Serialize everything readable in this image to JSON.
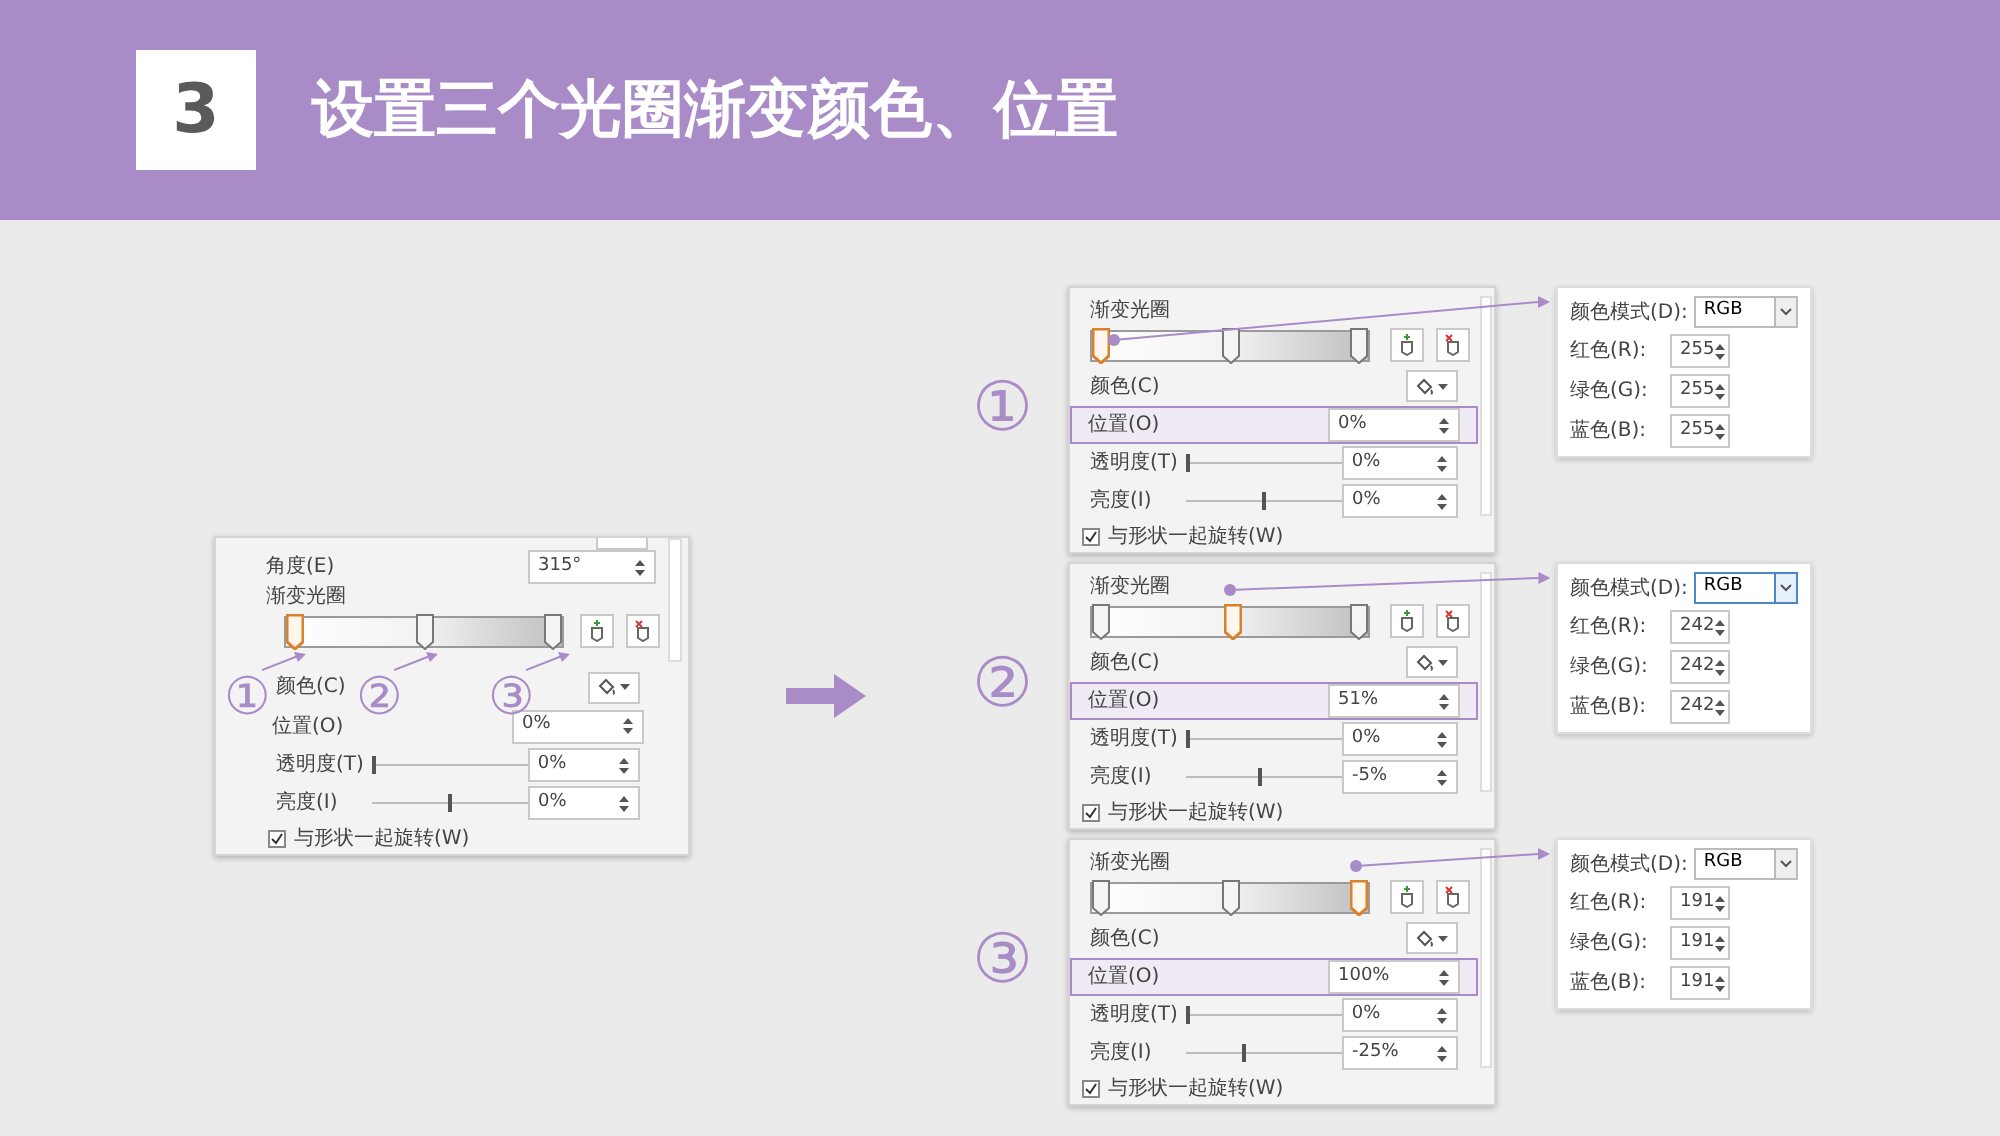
{
  "header": {
    "step": "3",
    "title": "设置三个光圈渐变颜色、位置"
  },
  "source_panel": {
    "angle_label": "角度(E)",
    "angle_value": "315°",
    "stops_label": "渐变光圈",
    "stops": [
      {
        "level": 0,
        "selected": true
      },
      {
        "level": 0.5,
        "selected": false
      },
      {
        "level": 1,
        "selected": false
      }
    ],
    "callouts": [
      "①",
      "②",
      "③"
    ],
    "color_label": "颜色(C)",
    "position": {
      "label": "位置(O)",
      "value": "0%"
    },
    "transparency": {
      "label": "透明度(T)",
      "level": 0,
      "value": "0%"
    },
    "brightness": {
      "label": "亮度(I)",
      "level": 0.5,
      "value": "0%"
    },
    "rotate": {
      "label": "与形状一起旋转(W)",
      "checked": true
    }
  },
  "steps": [
    {
      "number": "①",
      "panel": {
        "stops_label": "渐变光圈",
        "stops": [
          {
            "level": 0,
            "selected": true
          },
          {
            "level": 0.5,
            "selected": false
          },
          {
            "level": 1,
            "selected": false
          }
        ],
        "color_label": "颜色(C)",
        "position": {
          "label": "位置(O)",
          "value": "0%"
        },
        "transparency": {
          "label": "透明度(T)",
          "level": 0,
          "value": "0%"
        },
        "brightness": {
          "label": "亮度(I)",
          "level": 0.5,
          "value": "0%"
        },
        "rotate": {
          "label": "与形状一起旋转(W)",
          "checked": true
        }
      },
      "rgb": {
        "mode_label": "颜色模式(D):",
        "mode": "RGB",
        "mode_focused": false,
        "channels": [
          {
            "label": "红色(R):",
            "value": "255"
          },
          {
            "label": "绿色(G):",
            "value": "255"
          },
          {
            "label": "蓝色(B):",
            "value": "255"
          }
        ]
      }
    },
    {
      "number": "②",
      "panel": {
        "stops_label": "渐变光圈",
        "stops": [
          {
            "level": 0,
            "selected": false
          },
          {
            "level": 0.51,
            "selected": true
          },
          {
            "level": 1,
            "selected": false
          }
        ],
        "color_label": "颜色(C)",
        "position": {
          "label": "位置(O)",
          "value": "51%"
        },
        "transparency": {
          "label": "透明度(T)",
          "level": 0,
          "value": "0%"
        },
        "brightness": {
          "label": "亮度(I)",
          "level": 0.47,
          "value": "-5%"
        },
        "rotate": {
          "label": "与形状一起旋转(W)",
          "checked": true
        }
      },
      "rgb": {
        "mode_label": "颜色模式(D):",
        "mode": "RGB",
        "mode_focused": true,
        "channels": [
          {
            "label": "红色(R):",
            "value": "242"
          },
          {
            "label": "绿色(G):",
            "value": "242"
          },
          {
            "label": "蓝色(B):",
            "value": "242"
          }
        ]
      }
    },
    {
      "number": "③",
      "panel": {
        "stops_label": "渐变光圈",
        "stops": [
          {
            "level": 0,
            "selected": false
          },
          {
            "level": 0.5,
            "selected": false
          },
          {
            "level": 1,
            "selected": true
          }
        ],
        "color_label": "颜色(C)",
        "position": {
          "label": "位置(O)",
          "value": "100%"
        },
        "transparency": {
          "label": "透明度(T)",
          "level": 0,
          "value": "0%"
        },
        "brightness": {
          "label": "亮度(I)",
          "level": 0.37,
          "value": "-25%"
        },
        "rotate": {
          "label": "与形状一起旋转(W)",
          "checked": true
        }
      },
      "rgb": {
        "mode_label": "颜色模式(D):",
        "mode": "RGB",
        "mode_focused": false,
        "channels": [
          {
            "label": "红色(R):",
            "value": "191"
          },
          {
            "label": "绿色(G):",
            "value": "191"
          },
          {
            "label": "蓝色(B):",
            "value": "191"
          }
        ]
      }
    }
  ]
}
